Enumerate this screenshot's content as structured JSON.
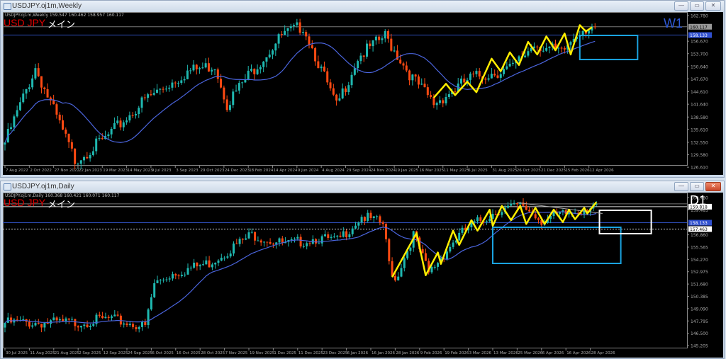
{
  "colors": {
    "bull": "#1fb8b0",
    "bear": "#ff4a12",
    "ma": "#4a64dc",
    "zigzag": "#ffee00",
    "box_blue": "#1aa3e0",
    "box_white": "#ffffff",
    "bg": "#000000"
  },
  "weekly": {
    "window_title": "USDJPY.oj1m,Weekly",
    "header": "USDJPY.oj1m,Weekly  159.547 160.462 158.957 160.117",
    "symbol": "USD JPY",
    "subtitle": "メイン",
    "timeframe": "W1",
    "price_labels": [
      "162.780",
      "156.670",
      "153.700",
      "150.640",
      "147.670",
      "144.610",
      "141.640",
      "138.580",
      "135.610",
      "132.550",
      "129.580",
      "126.610"
    ],
    "marked_prices": [
      {
        "value": "160.117",
        "style": "grey"
      },
      {
        "value": "158.133",
        "style": "blue"
      }
    ],
    "time_labels": [
      "7 Aug 2022",
      "2 Oct 2022",
      "27 Nov 2022",
      "22 Jan 2023",
      "19 Mar 2023",
      "14 May 2023",
      "9 Jul 2023",
      "3 Sep 2023",
      "29 Oct 2023",
      "24 Dec 2023",
      "18 Feb 2024",
      "14 Apr 2024",
      "9 Jun 2024",
      "4 Aug 2024",
      "29 Sep 2024",
      "24 Nov 2024",
      "19 Jan 2025",
      "16 Mar 2025",
      "11 May 2025",
      "6 Jul 2025",
      "31 Aug 2025",
      "26 Oct 2025",
      "21 Dec 2025",
      "15 Feb 2026",
      "12 Apr 2026"
    ]
  },
  "daily": {
    "window_title": "USDJPY.oj1m,Daily",
    "header": "USDJPY.oj1m,Daily  160.368 160.421 160.071 160.117",
    "symbol": "USD JPY",
    "subtitle": "メイン",
    "timeframe": "D1",
    "price_labels": [
      "160.780",
      "159.485",
      "156.860",
      "155.565",
      "154.270",
      "152.975",
      "151.680",
      "150.385",
      "149.090",
      "147.795",
      "146.500",
      "145.205"
    ],
    "marked_prices": [
      {
        "value": "159.818",
        "style": "white"
      },
      {
        "value": "158.133",
        "style": "blue"
      },
      {
        "value": "157.463",
        "style": "white"
      }
    ],
    "time_labels": [
      "30 Jul 2025",
      "11 Aug 2025",
      "21 Aug 2025",
      "2 Sep 2025",
      "12 Sep 2025",
      "24 Sep 2025",
      "6 Oct 2025",
      "16 Oct 2025",
      "28 Oct 2025",
      "7 Nov 2025",
      "19 Nov 2025",
      "1 Dec 2025",
      "11 Dec 2025",
      "23 Dec 2025",
      "6 Jan 2026",
      "16 Jan 2026",
      "28 Jan 2026",
      "9 Feb 2026",
      "19 Feb 2026",
      "3 Mar 2026",
      "13 Mar 2026",
      "25 Mar 2026",
      "6 Apr 2026",
      "16 Apr 2026",
      "28 Apr 2026"
    ]
  },
  "chart_data": [
    {
      "type": "candlestick",
      "title": "USDJPY.oj1m,Weekly",
      "ylim": [
        126.61,
        162.78
      ],
      "bars": 195,
      "ma_period": 20,
      "close_waypoints": [
        [
          0,
          132.5
        ],
        [
          10,
          150.3
        ],
        [
          23,
          128.3
        ],
        [
          33,
          133.4
        ],
        [
          46,
          142.7
        ],
        [
          60,
          149.4
        ],
        [
          69,
          151.0
        ],
        [
          73,
          141.8
        ],
        [
          81,
          149.4
        ],
        [
          91,
          157.9
        ],
        [
          98,
          160.4
        ],
        [
          109,
          141.0
        ],
        [
          116,
          152.8
        ],
        [
          125,
          157.9
        ],
        [
          134,
          147.8
        ],
        [
          141,
          141.8
        ],
        [
          153,
          147.8
        ],
        [
          167,
          150.3
        ],
        [
          174,
          156.2
        ],
        [
          183,
          153.7
        ],
        [
          189,
          159.6
        ],
        [
          194,
          160.117
        ]
      ],
      "zigzag": [
        [
          141,
          143.2
        ],
        [
          145,
          146.5
        ],
        [
          148,
          143.8
        ],
        [
          152,
          147.0
        ],
        [
          155,
          144.5
        ],
        [
          160,
          152.5
        ],
        [
          163,
          149.5
        ],
        [
          166,
          154.0
        ],
        [
          169,
          151.0
        ],
        [
          172,
          156.5
        ],
        [
          175,
          153.5
        ],
        [
          178,
          157.8
        ],
        [
          181,
          154.5
        ],
        [
          184,
          158.5
        ],
        [
          186,
          153.5
        ],
        [
          189,
          160.5
        ],
        [
          191,
          159.0
        ],
        [
          193,
          160.0
        ]
      ],
      "boxes": [
        {
          "color": "blue",
          "from": 189,
          "to": 208,
          "top": 158.05,
          "bottom": 152.3
        }
      ],
      "hlines": [
        {
          "price": 158.133,
          "color": "blue"
        },
        {
          "price": 160.117,
          "color": "grey"
        }
      ]
    },
    {
      "type": "candlestick",
      "title": "USDJPY.oj1m,Daily",
      "ylim": [
        145.205,
        160.78
      ],
      "bars": 195,
      "ma_period": 20,
      "close_waypoints": [
        [
          0,
          147.6
        ],
        [
          23,
          147.6
        ],
        [
          34,
          148.0
        ],
        [
          46,
          147.2
        ],
        [
          49,
          151.7
        ],
        [
          55,
          152.8
        ],
        [
          67,
          153.9
        ],
        [
          76,
          155.8
        ],
        [
          81,
          156.9
        ],
        [
          92,
          155.8
        ],
        [
          102,
          156.5
        ],
        [
          109,
          156.2
        ],
        [
          117,
          158.8
        ],
        [
          124,
          158.0
        ],
        [
          126,
          153.9
        ],
        [
          128,
          152.1
        ],
        [
          134,
          156.9
        ],
        [
          139,
          152.8
        ],
        [
          148,
          156.5
        ],
        [
          152,
          157.6
        ],
        [
          162,
          159.5
        ],
        [
          170,
          159.9
        ],
        [
          176,
          158.4
        ],
        [
          185,
          159.1
        ],
        [
          194,
          160.117
        ]
      ],
      "zigzag": [
        [
          127,
          152.4
        ],
        [
          135,
          157.05
        ],
        [
          138,
          152.6
        ],
        [
          142,
          155.0
        ],
        [
          143,
          153.8
        ],
        [
          147,
          157.3
        ],
        [
          149,
          155.8
        ],
        [
          153,
          158.4
        ],
        [
          155,
          157.3
        ],
        [
          159,
          159.5
        ],
        [
          160,
          157.8
        ],
        [
          163,
          159.9
        ],
        [
          166,
          158.4
        ],
        [
          169,
          159.9
        ],
        [
          171,
          158.0
        ],
        [
          174,
          159.7
        ],
        [
          177,
          158.0
        ],
        [
          180,
          159.5
        ],
        [
          183,
          158.2
        ],
        [
          185,
          159.5
        ],
        [
          187,
          158.5
        ],
        [
          190,
          159.7
        ],
        [
          191,
          159.1
        ],
        [
          194,
          160.3
        ]
      ],
      "trendline": [
        [
          168,
          160.26
        ],
        [
          196,
          159.1
        ]
      ],
      "boxes": [
        {
          "color": "blue",
          "from": 160,
          "to": 202,
          "top": 157.65,
          "bottom": 153.85
        },
        {
          "color": "white",
          "from": 195,
          "to": 212,
          "top": 159.44,
          "bottom": 156.98
        }
      ],
      "hlines": [
        {
          "price": 159.818,
          "color": "white"
        },
        {
          "price": 158.133,
          "color": "blue"
        },
        {
          "price": 157.463,
          "color": "white-dotted"
        },
        {
          "price": 160.117,
          "color": "grey"
        }
      ]
    }
  ]
}
